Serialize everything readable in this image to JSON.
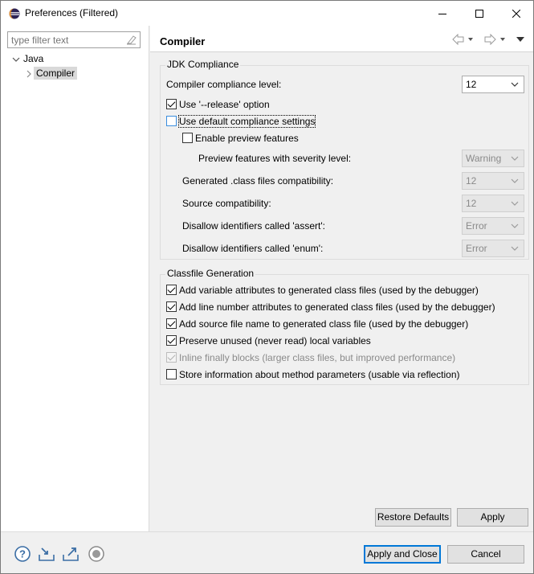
{
  "window": {
    "title": "Preferences (Filtered)"
  },
  "filter": {
    "placeholder": "type filter text"
  },
  "tree": {
    "root_label": "Java",
    "child_label": "Compiler"
  },
  "page": {
    "title": "Compiler"
  },
  "jdk": {
    "group_title": "JDK Compliance",
    "compliance_level_label": "Compiler compliance level:",
    "compliance_level_value": "12",
    "release_option_label": "Use '--release' option",
    "release_option_checked": true,
    "default_settings_label": "Use default compliance settings",
    "default_settings_checked": false,
    "preview_label": "Enable preview features",
    "preview_checked": false,
    "preview_severity_label": "Preview features with severity level:",
    "preview_severity_value": "Warning",
    "class_compat_label": "Generated .class files compatibility:",
    "class_compat_value": "12",
    "source_compat_label": "Source compatibility:",
    "source_compat_value": "12",
    "assert_label": "Disallow identifiers called 'assert':",
    "assert_value": "Error",
    "enum_label": "Disallow identifiers called 'enum':",
    "enum_value": "Error"
  },
  "classfile": {
    "group_title": "Classfile Generation",
    "items": [
      {
        "label": "Add variable attributes to generated class files (used by the debugger)",
        "checked": true,
        "enabled": true
      },
      {
        "label": "Add line number attributes to generated class files (used by the debugger)",
        "checked": true,
        "enabled": true
      },
      {
        "label": "Add source file name to generated class file (used by the debugger)",
        "checked": true,
        "enabled": true
      },
      {
        "label": "Preserve unused (never read) local variables",
        "checked": true,
        "enabled": true
      },
      {
        "label": "Inline finally blocks (larger class files, but improved performance)",
        "checked": true,
        "enabled": false
      },
      {
        "label": "Store information about method parameters (usable via reflection)",
        "checked": false,
        "enabled": true
      }
    ]
  },
  "buttons": {
    "restore_defaults": "Restore Defaults",
    "apply": "Apply",
    "apply_and_close": "Apply and Close",
    "cancel": "Cancel"
  },
  "icons": {
    "help": "help-icon",
    "import": "import-icon",
    "export": "export-icon",
    "oomph": "record-icon"
  }
}
